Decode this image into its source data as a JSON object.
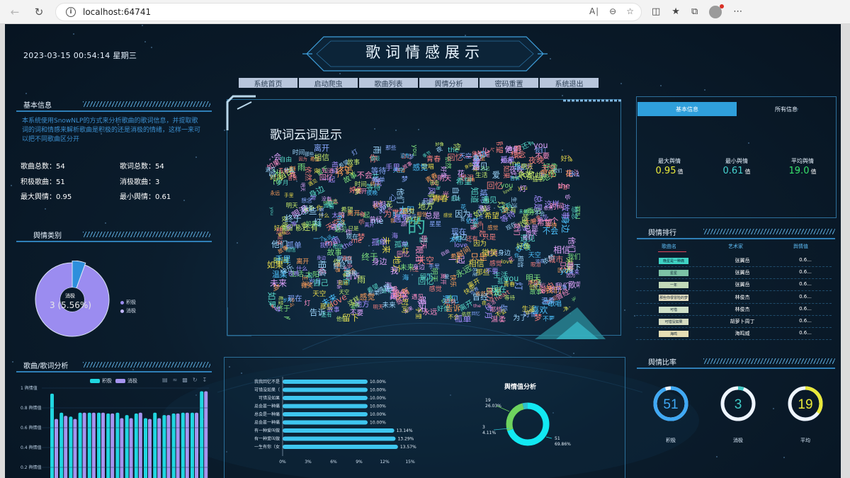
{
  "browser": {
    "url": "localhost:64741",
    "info_icon": "info-icon",
    "icons": [
      "back-icon",
      "refresh-icon",
      "read-aloud-icon",
      "zoom-out-icon",
      "favorite-add-icon",
      "split-screen-icon",
      "favorites-icon",
      "collections-icon",
      "profile-icon"
    ]
  },
  "header": {
    "datetime": "2023-03-15  00:54:14  星期三",
    "title": "歌词情感展示"
  },
  "menu": [
    "系统首页",
    "启动爬虫",
    "歌曲列表",
    "舆情分析",
    "密码重置",
    "系统退出"
  ],
  "basic_info": {
    "title": "基本信息",
    "description": "本系统使用SnowNLP的方式来分析歌曲的歌词信息，并提取歌词的词和情感来解析歌曲是积极的还是消极的情绪，这样一来可以把不同歌曲区分开",
    "stats": {
      "song_total_label": "歌曲总数：",
      "song_total": "54",
      "lyric_total_label": "歌词总数：",
      "lyric_total": "54",
      "positive_label": "积极歌曲：",
      "positive": "51",
      "negative_label": "消极歌曲：",
      "negative": "3",
      "max_label": "最大舆情：",
      "max": "0.95",
      "min_label": "最小舆情：",
      "min": "0.61"
    }
  },
  "sentiment_category": {
    "title": "舆情类别",
    "center_label": "消极",
    "center_value": "3 (5.56%)",
    "legend": [
      "积极",
      "消极"
    ],
    "values": [
      51,
      3
    ],
    "colors": [
      "#9b8cf0",
      "#2e8fdc"
    ]
  },
  "song_lyric_analysis": {
    "title": "歌曲/歌词分析",
    "legend": [
      "积极",
      "消极"
    ],
    "y_ticks": [
      "1 舆情值",
      "0.8 舆情值",
      "0.6 舆情值",
      "0.4 舆情值",
      "0.2 舆情值"
    ],
    "colors": [
      "#20d6e0",
      "#a594f0"
    ]
  },
  "word_cloud": {
    "title": "歌词云词显示",
    "center_word": "的",
    "words": [
      "我",
      "你",
      "爱",
      "心",
      "梦",
      "风",
      "时间",
      "世界",
      "一个",
      "不会",
      "没有",
      "自己",
      "什么",
      "天空",
      "永远",
      "回忆",
      "我们",
      "他们",
      "生活",
      "快乐",
      "温柔",
      "想念",
      "孤单",
      "太阳",
      "身边",
      "未来",
      "季节",
      "眼泪",
      "微笑",
      "城市",
      "等待",
      "依然",
      "声音",
      "明天",
      "遇见",
      "故事",
      "岁月",
      "夜晚",
      "星星",
      "love",
      "you",
      "the",
      "me",
      "heart",
      "一起",
      "希望",
      "青春",
      "留下",
      "离开",
      "相信",
      "告诉",
      "手里",
      "还有",
      "总是",
      "如果",
      "终于",
      "只是",
      "为了",
      "因为",
      "好像",
      "这样",
      "曾经",
      "现在",
      "那些",
      "地方",
      "感觉",
      "不要",
      "知道",
      "喜欢",
      "自由",
      "歌唱",
      "光",
      "花",
      "海",
      "雨",
      "夜",
      "灯"
    ]
  },
  "right_info": {
    "tabs": [
      "基本信息",
      "所有信息"
    ],
    "max_label": "最大舆情",
    "max_value": "0.95",
    "max_unit": "值",
    "min_label": "最小舆情",
    "min_value": "0.61",
    "min_unit": "值",
    "avg_label": "平均舆情",
    "avg_value": "19.0",
    "avg_unit": "值"
  },
  "ranking": {
    "title": "舆情排行",
    "headers": [
      "歌曲名",
      "艺术家",
      "舆情值"
    ],
    "rows": [
      {
        "song": "晚星是一种痛",
        "artist": "张翼岳",
        "value": "0.6...",
        "color": "#3fd3c5"
      },
      {
        "song": "星星",
        "artist": "张翼岳",
        "value": "0.6...",
        "color": "#7cc2a5"
      },
      {
        "song": "一年",
        "artist": "张翼岳",
        "value": "0.6...",
        "color": "#c2d9b8"
      },
      {
        "song": "那些你很冒险的梦",
        "artist": "林俊杰",
        "value": "0.6...",
        "color": "#e8e1c3"
      },
      {
        "song": "可惜",
        "artist": "林俊杰",
        "value": "0.6...",
        "color": "#cfe0c8"
      },
      {
        "song": "可惜没如果",
        "artist": "胡萝卜周丁",
        "value": "0.6...",
        "color": "#d6dcc1"
      },
      {
        "song": "海鸣",
        "artist": "海鸣威",
        "value": "0.6...",
        "color": "#e6ddb4"
      }
    ]
  },
  "ratio": {
    "title": "舆情比率",
    "gauges": [
      {
        "value": "51",
        "label": "积极",
        "fraction": 0.944,
        "color": "#3fa9f5",
        "text_color": "#3fa9f5"
      },
      {
        "value": "3",
        "label": "消极",
        "fraction": 0.056,
        "color": "#3fc9c5",
        "text_color": "#3fc9c5"
      },
      {
        "value": "19",
        "label": "平均",
        "fraction": 0.35,
        "color": "#e8e83a",
        "text_color": "#e8e83a"
      }
    ]
  },
  "bar_chart": {
    "labels": [
      "我我回忆不是",
      "可惜没如果（",
      "可惜没如果",
      "总会是一种痛",
      "总会是一种痛",
      "总会是一种痛",
      "有一种爱叫做",
      "有一种爱叫做",
      "一生有你（女"
    ],
    "values": [
      "10.00%",
      "10.00%",
      "10.00%",
      "10.00%",
      "10.00%",
      "10.00%",
      "13.14%",
      "13.29%",
      "13.57%"
    ],
    "x_ticks": [
      "0%",
      "3%",
      "6%",
      "9%",
      "12%",
      "15%"
    ]
  },
  "chart_data": [
    {
      "type": "bar",
      "categories": [
        "我我回忆不是",
        "可惜没如果（",
        "可惜没如果",
        "总会是一种痛",
        "总会是一种痛",
        "总会是一种痛",
        "有一种爱叫做",
        "有一种爱叫做",
        "一生有你（女"
      ],
      "values": [
        10.0,
        10.0,
        10.0,
        10.0,
        10.0,
        10.0,
        13.14,
        13.29,
        13.57
      ],
      "xlim": [
        0,
        15
      ],
      "orientation": "horizontal"
    },
    {
      "type": "pie",
      "title": "舆情值分析",
      "categories": [
        "19",
        "3",
        "51"
      ],
      "values": [
        26.03,
        4.11,
        69.86
      ],
      "labels": [
        "19\n26.03%",
        "3\n4.11%",
        "51\n69.86%"
      ],
      "colors": [
        "#6ed35e",
        "#2dc0d0",
        "#12e8f2"
      ]
    }
  ],
  "donut": {
    "title": "舆情值分析",
    "labels": [
      {
        "count": "19",
        "pct": "26.03%"
      },
      {
        "count": "3",
        "pct": "4.11%"
      },
      {
        "count": "51",
        "pct": "69.86%"
      }
    ]
  }
}
